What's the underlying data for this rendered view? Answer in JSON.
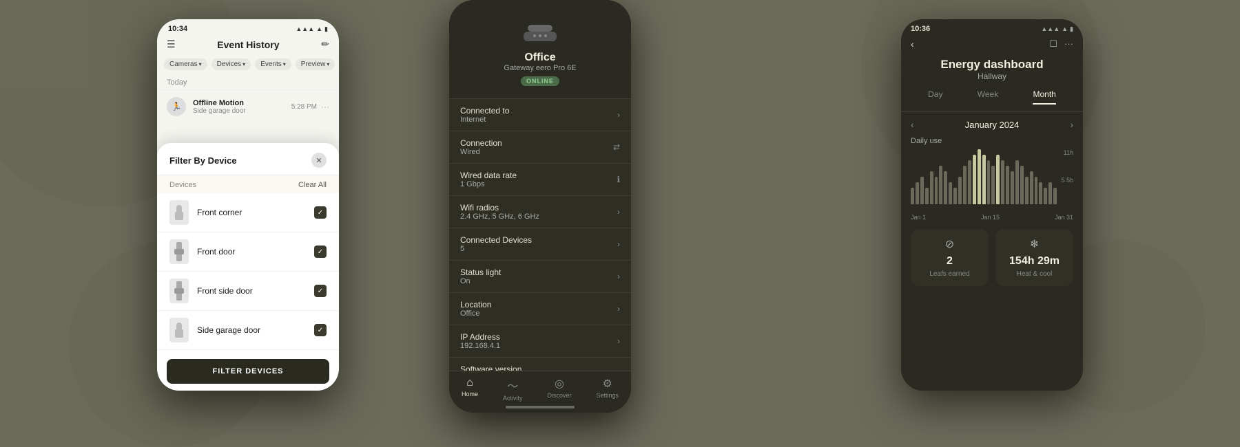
{
  "background": {
    "color": "#6b6b5a"
  },
  "phone1": {
    "status_bar": {
      "time": "10:34",
      "battery_icon": "🔋",
      "wifi_icon": "▲",
      "signal_icon": "●●●"
    },
    "header": {
      "menu_label": "☰",
      "title": "Event History",
      "edit_label": "✏"
    },
    "filters": [
      {
        "label": "Cameras",
        "arrow": "▾"
      },
      {
        "label": "Devices",
        "arrow": "▾"
      },
      {
        "label": "Events",
        "arrow": "▾"
      },
      {
        "label": "Preview",
        "arrow": "▾"
      }
    ],
    "today_label": "Today",
    "events": [
      {
        "icon": "🏃",
        "name": "Offline Motion",
        "device": "Side garage door",
        "time": "5:28 PM",
        "more": "···"
      }
    ],
    "filter_overlay": {
      "title": "Filter By Device",
      "close_label": "✕",
      "devices_label": "Devices",
      "clear_all_label": "Clear All",
      "devices": [
        {
          "name": "Front corner",
          "checked": true
        },
        {
          "name": "Front door",
          "checked": true
        },
        {
          "name": "Front side door",
          "checked": true
        },
        {
          "name": "Side garage door",
          "checked": true
        }
      ],
      "filter_button_label": "FILTER DEVICES"
    }
  },
  "phone2": {
    "device_name": "Office",
    "device_model": "Gateway eero Pro 6E",
    "online_status": "ONLINE",
    "list_items": [
      {
        "label": "Connected to",
        "value": "Internet",
        "type": "arrow"
      },
      {
        "label": "Connection",
        "value": "Wired",
        "type": "bidirectional"
      },
      {
        "label": "Wired data rate",
        "value": "1 Gbps",
        "type": "info"
      },
      {
        "label": "Wifi radios",
        "value": "2.4 GHz, 5 GHz, 6 GHz",
        "type": "arrow"
      },
      {
        "label": "Connected Devices",
        "value": "5",
        "type": "arrow"
      },
      {
        "label": "Status light",
        "value": "On",
        "type": "arrow"
      },
      {
        "label": "Location",
        "value": "Office",
        "type": "arrow"
      },
      {
        "label": "IP Address",
        "value": "192.168.4.1",
        "type": "arrow"
      },
      {
        "label": "Software version",
        "value": "",
        "type": "none"
      }
    ],
    "nav_items": [
      {
        "icon": "⌂",
        "label": "Home",
        "active": true
      },
      {
        "icon": "⚡",
        "label": "Activity",
        "active": false
      },
      {
        "icon": "◉",
        "label": "Discover",
        "active": false
      },
      {
        "icon": "⚙",
        "label": "Settings",
        "active": false
      }
    ]
  },
  "phone3": {
    "status_bar": {
      "time": "10:36",
      "icons": "🔋"
    },
    "nav": {
      "back_label": "‹",
      "calendar_icon": "📅",
      "more_icon": "···"
    },
    "title": "Energy dashboard",
    "subtitle": "Hallway",
    "tabs": [
      {
        "label": "Day",
        "active": false
      },
      {
        "label": "Week",
        "active": false
      },
      {
        "label": "Month",
        "active": true
      }
    ],
    "month_nav": {
      "prev_label": "‹",
      "month": "January 2024",
      "next_label": "›"
    },
    "daily_use_label": "Daily use",
    "chart": {
      "y_labels": [
        "11h",
        "5.5h"
      ],
      "x_labels": [
        "Jan 1",
        "Jan 15",
        "Jan 31"
      ],
      "bars": [
        3,
        4,
        5,
        3,
        6,
        5,
        7,
        6,
        4,
        3,
        5,
        7,
        8,
        9,
        10,
        9,
        8,
        7,
        9,
        8,
        7,
        6,
        8,
        7,
        5,
        6,
        5,
        4,
        3,
        4,
        3
      ]
    },
    "stats": [
      {
        "icon": "⊘",
        "value": "2",
        "label": "Leafs earned"
      },
      {
        "icon": "❄",
        "value": "154h 29m",
        "label": "Heat & cool"
      }
    ]
  }
}
